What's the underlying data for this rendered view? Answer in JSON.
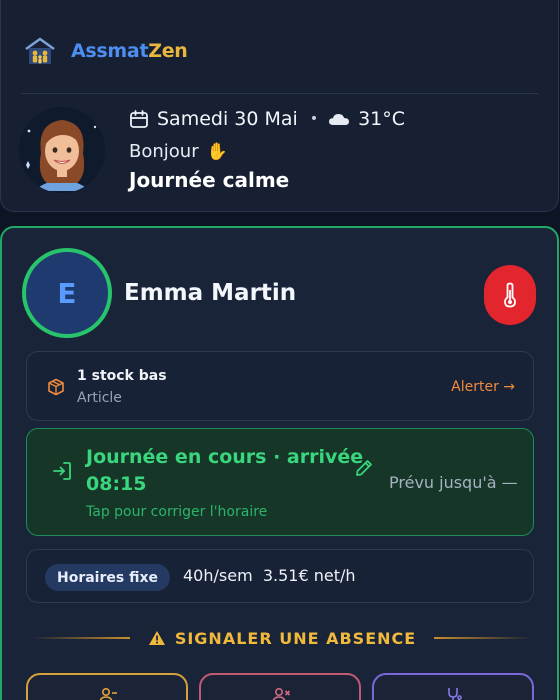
{
  "header": {
    "brand_part1": "Assmat",
    "brand_part2": "Zen",
    "date": "Samedi 30 Mai",
    "separator": "•",
    "temperature": "31°C",
    "greeting": "Bonjour",
    "day_status": "Journée calme"
  },
  "child": {
    "initial": "E",
    "name": "Emma Martin"
  },
  "stock": {
    "title": "1 stock bas",
    "subtitle": "Article",
    "action": "Alerter →"
  },
  "day": {
    "status": "Journée en cours · arrivée",
    "arrival_time": "08:15",
    "hint": "Tap pour corriger l'horaire",
    "planned": "Prévu jusqu'à —"
  },
  "schedule": {
    "badge": "Horaires fixe",
    "values": "40h/sem  3.51€ net/h"
  },
  "absence": {
    "label": "SIGNALER UNE ABSENCE"
  },
  "colors": {
    "accent_green": "#27c46b",
    "brand_blue": "#4d8ef0",
    "brand_gold": "#e9b73e",
    "alert_red": "#e3262e"
  }
}
